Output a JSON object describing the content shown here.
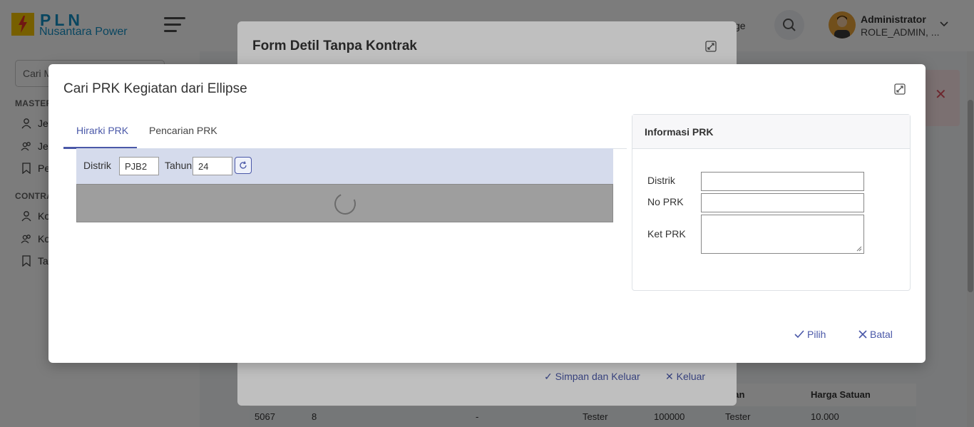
{
  "app": {
    "logo_title": "PLN",
    "logo_subtitle": "Nusantara Power",
    "lang_label": "ge",
    "user_name": "Administrator",
    "user_role": "ROLE_ADMIN, ..."
  },
  "sidebar": {
    "search_placeholder": "Cari M",
    "section_master": "MASTER",
    "section_contract": "CONTRA",
    "items": [
      {
        "label": "Je",
        "icon": "user-icon"
      },
      {
        "label": "Je",
        "icon": "users-icon"
      },
      {
        "label": "Pel",
        "icon": "bookmark-icon"
      },
      {
        "label": "Ko",
        "icon": "user-icon"
      },
      {
        "label": "Ko",
        "icon": "users-icon"
      },
      {
        "label": "Tar",
        "icon": "bookmark-icon"
      }
    ]
  },
  "table": {
    "headers": [
      "tuan",
      "Harga Satuan"
    ],
    "row": [
      "5067",
      "8",
      "-",
      "Tester",
      "100000",
      "Tester",
      "10.000"
    ]
  },
  "form_modal": {
    "title": "Form Detil Tanpa Kontrak",
    "save_exit_label": "Simpan dan Keluar",
    "exit_label": "Keluar"
  },
  "prk_modal": {
    "title": "Cari PRK Kegiatan dari Ellipse",
    "tabs": [
      {
        "label": "Hirarki PRK",
        "active": true
      },
      {
        "label": "Pencarian PRK",
        "active": false
      }
    ],
    "filter": {
      "distrik_label": "Distrik",
      "distrik_value": "PJB2",
      "tahun_label": "Tahun",
      "tahun_value": "24"
    },
    "info": {
      "heading": "Informasi PRK",
      "distrik_label": "Distrik",
      "no_prk_label": "No PRK",
      "ket_prk_label": "Ket PRK"
    },
    "pilih_label": "Pilih",
    "batal_label": "Batal"
  },
  "colors": {
    "accent": "#4a58a8",
    "brand_blue": "#1591c7",
    "filter_bg": "#d5dbec",
    "toast_bg": "#fde6e8"
  }
}
